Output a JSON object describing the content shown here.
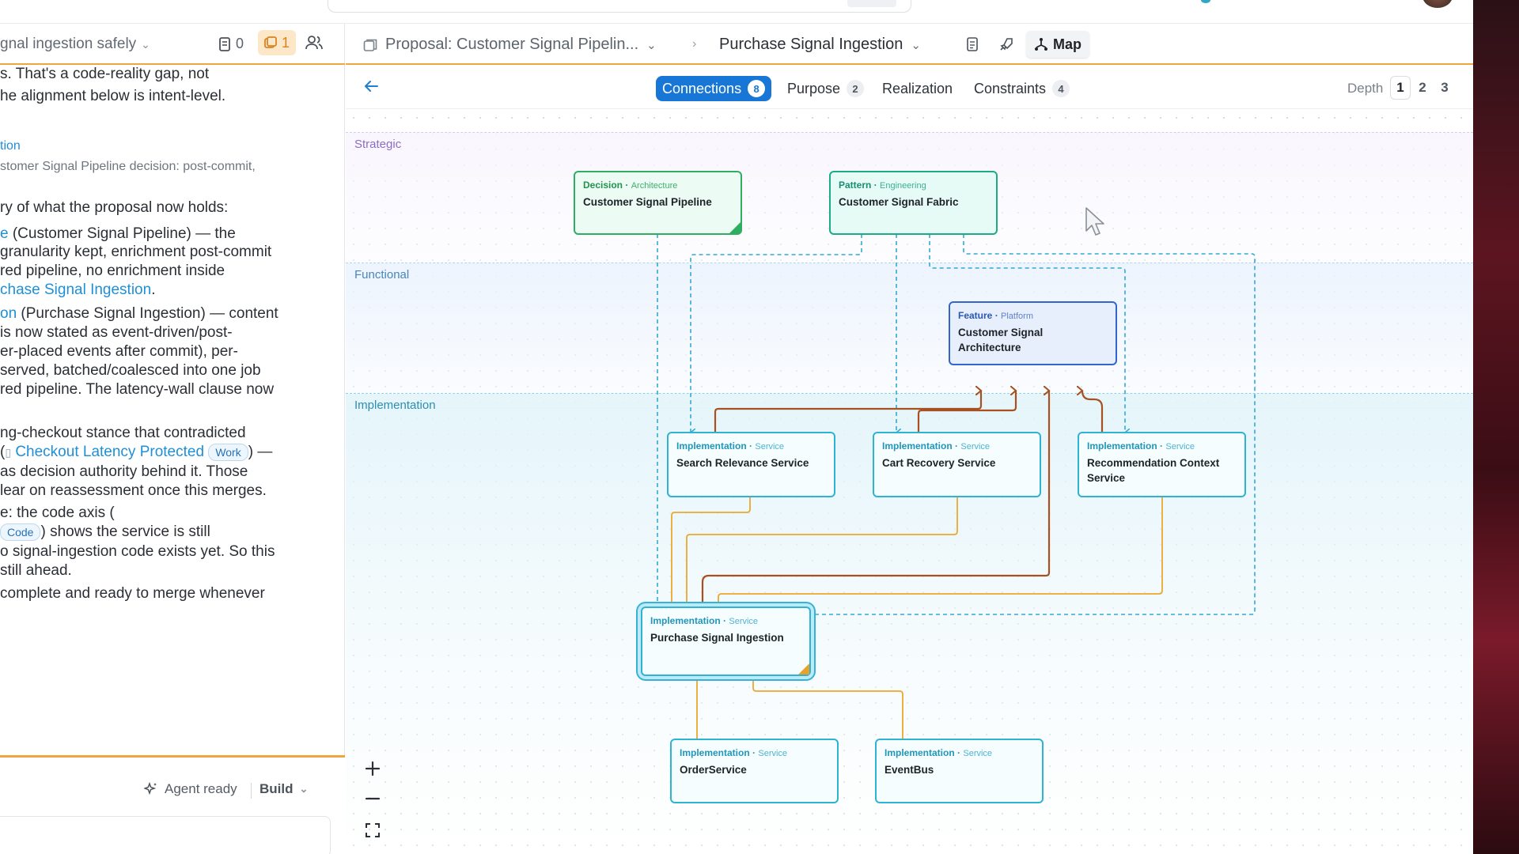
{
  "left": {
    "title": "gnal ingestion safely",
    "doc_count": "0",
    "issue_count": "1",
    "lines": {
      "l1": "s. That's a code-reality gap, not",
      "l2": "he alignment below is intent-level.",
      "l3": "tion",
      "l4": "stomer Signal Pipeline decision: post-commit,",
      "l5": "ry of what the proposal now holds:",
      "l6a": "e",
      "l6b": " (Customer Signal Pipeline) — the",
      "l7": " granularity kept, enrichment post-commit",
      "l8": "red pipeline, no enrichment inside",
      "l9a": "chase Signal Ingestion",
      "l9b": ".",
      "l10a": "on",
      "l10b": " (Purchase Signal Ingestion) — content",
      "l11": " is now stated as event-driven/post-",
      "l12": "er-placed events after commit), per-",
      "l13": "served, batched/coalesced into one job",
      "l14": "red pipeline. The latency-wall clause now",
      "l15": "ng-checkout stance that contradicted",
      "l16a": "(",
      "l16b": "Checkout Latency Protected",
      "l16c": "Work",
      "l16d": ") —",
      "l17": "as decision authority behind it. Those",
      "l18": "lear on reassessment once this merges.",
      "l19": "e: the code axis (",
      "l20a": "Code",
      "l20b": ") shows the service is still",
      "l21": "o signal-ingestion code exists yet. So this",
      "l22": " still ahead.",
      "l23": "complete and ready to merge whenever"
    },
    "agent_ready": "Agent ready",
    "build": "Build"
  },
  "header": {
    "proposal": "Proposal: Customer Signal Pipelin...",
    "node": "Purchase Signal Ingestion",
    "map_label": "Map"
  },
  "tabs": [
    {
      "label": "Connections",
      "count": "8"
    },
    {
      "label": "Purpose",
      "count": "2"
    },
    {
      "label": "Realization",
      "count": ""
    },
    {
      "label": "Constraints",
      "count": "4"
    }
  ],
  "depth": {
    "label": "Depth",
    "options": [
      "1",
      "2",
      "3"
    ],
    "selected": "1"
  },
  "bands": {
    "strategic": "Strategic",
    "functional": "Functional",
    "implementation": "Implementation"
  },
  "nodes": {
    "pipeline": {
      "kind": "Decision",
      "sub": "Architecture",
      "title": "Customer Signal Pipeline"
    },
    "fabric": {
      "kind": "Pattern",
      "sub": "Engineering",
      "title": "Customer Signal Fabric"
    },
    "architecture": {
      "kind": "Feature",
      "sub": "Platform",
      "title": "Customer Signal Architecture"
    },
    "search": {
      "kind": "Implementation",
      "sub": "Service",
      "title": "Search Relevance Service"
    },
    "cart": {
      "kind": "Implementation",
      "sub": "Service",
      "title": "Cart Recovery Service"
    },
    "reco": {
      "kind": "Implementation",
      "sub": "Service",
      "title": "Recommendation Context Service"
    },
    "purchase": {
      "kind": "Implementation",
      "sub": "Service",
      "title": "Purchase Signal Ingestion"
    },
    "order": {
      "kind": "Implementation",
      "sub": "Service",
      "title": "OrderService"
    },
    "eventbus": {
      "kind": "Implementation",
      "sub": "Service",
      "title": "EventBus"
    }
  },
  "colors": {
    "accent": "#1877d6",
    "divider_orange": "#f0a640",
    "edge_dashed": "#33a9d1",
    "edge_brown": "#a6511f",
    "edge_orange": "#eba82d"
  },
  "icons": [
    "document-icon",
    "issue-icon",
    "people-icon",
    "proposal-icon",
    "chevron-down-icon",
    "chevron-right-icon",
    "rocket-icon",
    "map-icon",
    "back-arrow-icon",
    "zoom-in-icon",
    "zoom-out-icon",
    "fit-view-icon",
    "sparkle-icon",
    "cursor-icon"
  ]
}
